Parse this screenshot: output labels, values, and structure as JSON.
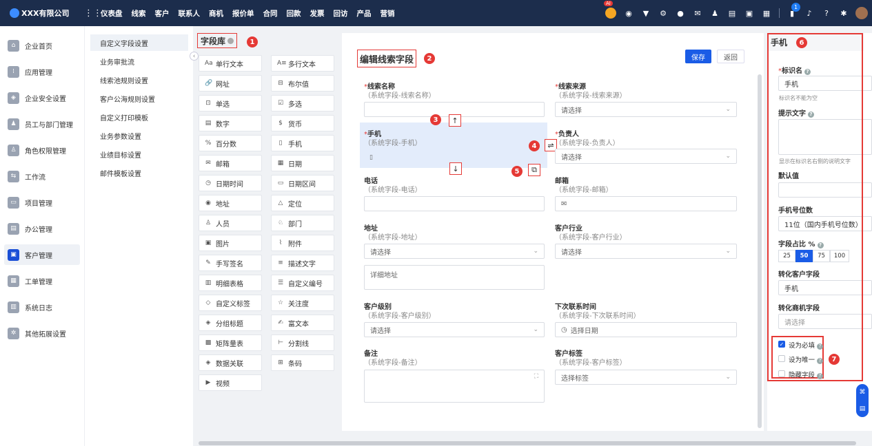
{
  "topbar": {
    "company": "XXX有限公司",
    "nav": [
      "仪表盘",
      "线索",
      "客户",
      "联系人",
      "商机",
      "报价单",
      "合同",
      "回款",
      "发票",
      "回访",
      "产品",
      "营销"
    ],
    "ai_badge": "AI",
    "notification_count": "1",
    "icons": [
      "robot-icon",
      "chat-icon",
      "message-icon",
      "settings-circle-icon",
      "globe-icon",
      "mail-icon",
      "contact-icon",
      "doc-icon",
      "calendar-icon",
      "table-icon",
      "notify-icon",
      "bell-icon",
      "help-icon",
      "gear-icon",
      "avatar"
    ]
  },
  "sidebar": {
    "items": [
      {
        "label": "企业首页",
        "icon": "home-icon"
      },
      {
        "label": "应用管理",
        "icon": "apps-icon"
      },
      {
        "label": "企业安全设置",
        "icon": "shield-icon"
      },
      {
        "label": "员工与部门管理",
        "icon": "people-icon"
      },
      {
        "label": "角色权限管理",
        "icon": "role-icon"
      },
      {
        "label": "工作流",
        "icon": "workflow-icon"
      },
      {
        "label": "项目管理",
        "icon": "project-icon"
      },
      {
        "label": "办公管理",
        "icon": "office-icon"
      },
      {
        "label": "客户管理",
        "icon": "customer-icon",
        "active": true
      },
      {
        "label": "工单管理",
        "icon": "ticket-icon"
      },
      {
        "label": "系统日志",
        "icon": "log-icon"
      },
      {
        "label": "其他拓展设置",
        "icon": "extension-icon"
      }
    ]
  },
  "submenu": {
    "items": [
      "自定义字段设置",
      "业务审批流",
      "线索池规则设置",
      "客户公海规则设置",
      "自定义打印模板",
      "业务参数设置",
      "业绩目标设置",
      "邮件模板设置"
    ]
  },
  "library": {
    "title": "字段库",
    "marker": "1",
    "fields": [
      {
        "label": "单行文本",
        "icon": "Aa"
      },
      {
        "label": "多行文本",
        "icon": "A≡"
      },
      {
        "label": "网址",
        "icon": "🔗"
      },
      {
        "label": "布尔值",
        "icon": "⊟"
      },
      {
        "label": "单选",
        "icon": "⊡"
      },
      {
        "label": "多选",
        "icon": "☑"
      },
      {
        "label": "数字",
        "icon": "▤"
      },
      {
        "label": "货币",
        "icon": "$"
      },
      {
        "label": "百分数",
        "icon": "%"
      },
      {
        "label": "手机",
        "icon": "▯"
      },
      {
        "label": "邮箱",
        "icon": "✉"
      },
      {
        "label": "日期",
        "icon": "▦"
      },
      {
        "label": "日期时间",
        "icon": "◷"
      },
      {
        "label": "日期区间",
        "icon": "▭"
      },
      {
        "label": "地址",
        "icon": "◉"
      },
      {
        "label": "定位",
        "icon": "△"
      },
      {
        "label": "人员",
        "icon": "♙"
      },
      {
        "label": "部门",
        "icon": "♘"
      },
      {
        "label": "图片",
        "icon": "▣"
      },
      {
        "label": "附件",
        "icon": "⌇"
      },
      {
        "label": "手写签名",
        "icon": "✎"
      },
      {
        "label": "描述文字",
        "icon": "≡"
      },
      {
        "label": "明细表格",
        "icon": "▥"
      },
      {
        "label": "自定义编号",
        "icon": "☰"
      },
      {
        "label": "自定义标签",
        "icon": "◇"
      },
      {
        "label": "关注度",
        "icon": "☆"
      },
      {
        "label": "分组标题",
        "icon": "◈"
      },
      {
        "label": "富文本",
        "icon": "✍"
      },
      {
        "label": "矩阵量表",
        "icon": "▩"
      },
      {
        "label": "分割线",
        "icon": "⊢"
      },
      {
        "label": "数据关联",
        "icon": "◈"
      },
      {
        "label": "条码",
        "icon": "⊞"
      },
      {
        "label": "视频",
        "icon": "▶"
      }
    ]
  },
  "editor": {
    "title": "编辑线索字段",
    "marker": "2",
    "save_label": "保存",
    "back_label": "返回",
    "move_up_marker": "3",
    "swap_marker": "4",
    "copy_marker": "5",
    "up_arrow": "↑",
    "down_arrow": "↓",
    "swap_icon": "⇌",
    "copy_icon": "⧉",
    "fields": {
      "name": {
        "label": "线索名称",
        "required": "*",
        "sub": "（系统字段-线索名称）"
      },
      "source": {
        "label": "线索来源",
        "required": "*",
        "sub": "（系统字段-线索来源）",
        "placeholder": "请选择"
      },
      "mobile": {
        "label": "手机",
        "required": "*",
        "sub": "（系统字段-手机）"
      },
      "owner": {
        "label": "负责人",
        "required": "*",
        "sub": "（系统字段-负责人）",
        "placeholder": "请选择"
      },
      "phone": {
        "label": "电话",
        "sub": "（系统字段-电话）"
      },
      "email": {
        "label": "邮箱",
        "sub": "（系统字段-邮箱）"
      },
      "address": {
        "label": "地址",
        "sub": "（系统字段-地址）",
        "placeholder": "请选择",
        "detail_placeholder": "详细地址"
      },
      "industry": {
        "label": "客户行业",
        "sub": "（系统字段-客户行业）",
        "placeholder": "请选择"
      },
      "level": {
        "label": "客户级别",
        "sub": "（系统字段-客户级别）",
        "placeholder": "请选择"
      },
      "next_contact": {
        "label": "下次联系时间",
        "sub": "（系统字段-下次联系时间）",
        "placeholder": "选择日期"
      },
      "remark": {
        "label": "备注",
        "sub": "（系统字段-备注）"
      },
      "tags": {
        "label": "客户标签",
        "sub": "（系统字段-客户标签）",
        "placeholder": "选择标签"
      }
    }
  },
  "properties": {
    "title": "手机",
    "marker": "6",
    "identifier_label": "标识名",
    "identifier_required": "*",
    "identifier_value": "手机",
    "identifier_hint": "标识名不能为空",
    "hint_label": "提示文字",
    "hint_help": "显示在标识名右侧的说明文字",
    "default_label": "默认值",
    "digits_label": "手机号位数",
    "digits_value": "11位（国内手机号位数）",
    "width_label": "字段占比 %",
    "width_options": [
      "25",
      "50",
      "75",
      "100"
    ],
    "width_selected": "50",
    "convert_customer_label": "转化客户字段",
    "convert_customer_value": "手机",
    "convert_opportunity_label": "转化商机字段",
    "convert_opportunity_placeholder": "请选择",
    "checkbox_marker": "7",
    "checkboxes": [
      {
        "label": "设为必填",
        "checked": true
      },
      {
        "label": "设为唯一",
        "checked": false
      },
      {
        "label": "隐藏字段",
        "checked": false
      }
    ]
  },
  "colors": {
    "topbar": "#1c2d4c",
    "accent": "#1a5ce6",
    "marker": "#e53935",
    "selected_field": "#e3ecfb"
  }
}
